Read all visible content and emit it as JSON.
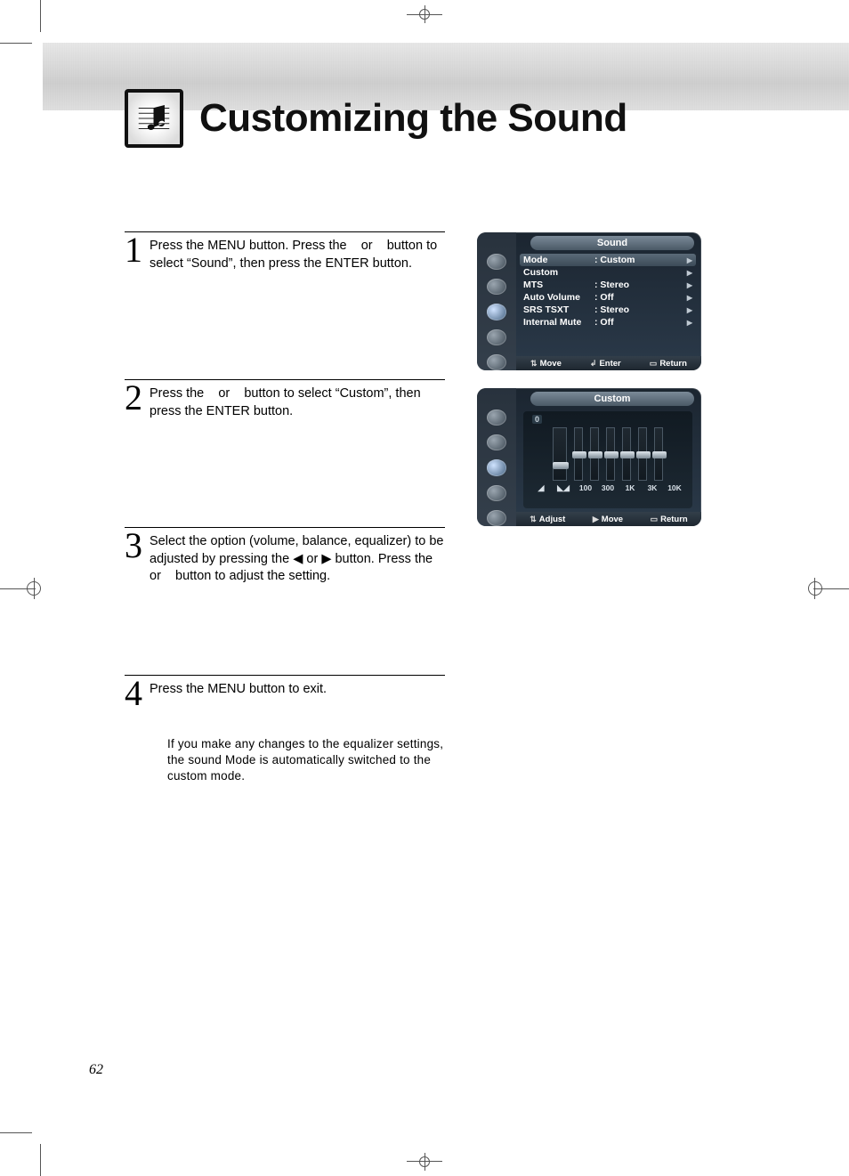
{
  "page_title": "Customizing the Sound",
  "page_number": "62",
  "steps": [
    {
      "num": "1",
      "text": "Press the MENU button. Press the    or    button to select “Sound”, then press the ENTER button."
    },
    {
      "num": "2",
      "text": "Press the    or    button to select “Custom”, then press the ENTER button."
    },
    {
      "num": "3",
      "text": "Select the option (volume, balance, equalizer) to be adjusted by pressing the ◀ or ▶ button. Press the    or    button to adjust the setting."
    },
    {
      "num": "4",
      "text": "Press the MENU button to exit."
    }
  ],
  "note": "If you make any changes to the equalizer settings, the sound Mode is automatically switched to the custom mode.",
  "osd_sound": {
    "title": "Sound",
    "rows": [
      {
        "label": "Mode",
        "value": ":  Custom"
      },
      {
        "label": "Custom",
        "value": ""
      },
      {
        "label": "MTS",
        "value": ":  Stereo"
      },
      {
        "label": "Auto Volume",
        "value": ":  Off"
      },
      {
        "label": "SRS TSXT",
        "value": ":  Stereo"
      },
      {
        "label": "Internal Mute",
        "value": ":  Off"
      }
    ],
    "footer": {
      "move": "Move",
      "enter": "Enter",
      "ret": "Return"
    }
  },
  "osd_custom": {
    "title": "Custom",
    "zero": "0",
    "bands": [
      "100",
      "300",
      "1K",
      "3K",
      "10K"
    ],
    "footer": {
      "adjust": "Adjust",
      "move": "Move",
      "ret": "Return"
    }
  }
}
